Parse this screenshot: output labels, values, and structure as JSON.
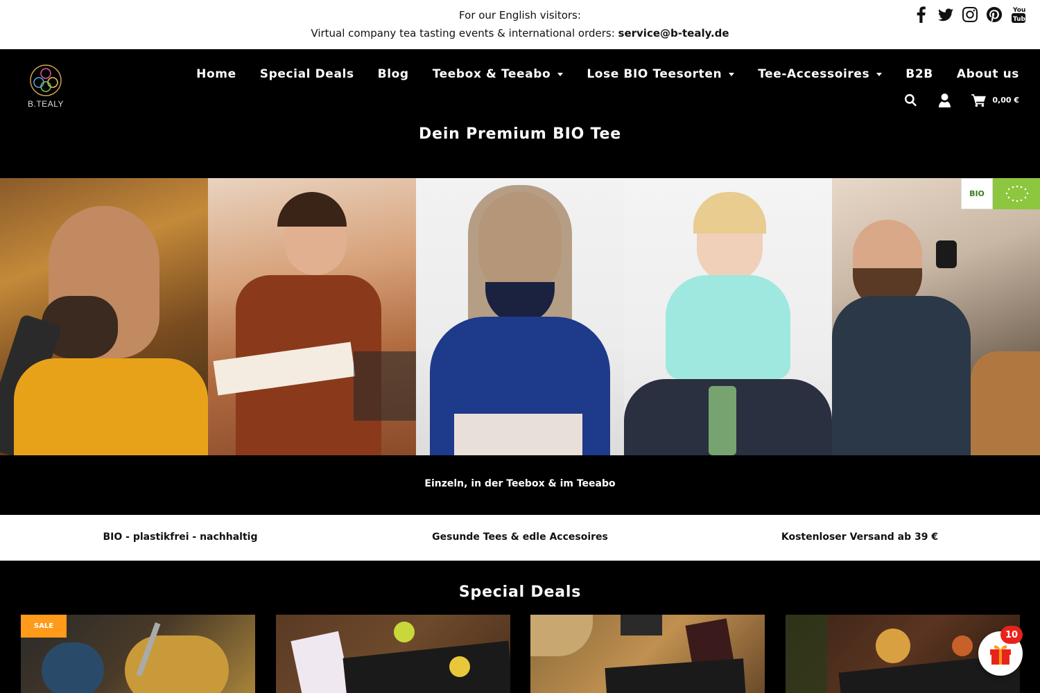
{
  "announcement": {
    "line1": "For our English visitors:",
    "line2_prefix": "Virtual company tea tasting events & international orders: ",
    "line2_email": "service@b-tealy.de"
  },
  "social": [
    "facebook-icon",
    "twitter-icon",
    "instagram-icon",
    "pinterest-icon",
    "youtube-icon"
  ],
  "logo": {
    "brand": "B.TEALY"
  },
  "nav": [
    {
      "label": "Home",
      "dropdown": false
    },
    {
      "label": "Special Deals",
      "dropdown": false
    },
    {
      "label": "Blog",
      "dropdown": false
    },
    {
      "label": "Teebox & Teeabo",
      "dropdown": true
    },
    {
      "label": "Lose BIO Teesorten",
      "dropdown": true
    },
    {
      "label": "Tee-Accessoires",
      "dropdown": true
    },
    {
      "label": "B2B",
      "dropdown": false
    },
    {
      "label": "About us",
      "dropdown": false
    }
  ],
  "cart": {
    "total": "0,00 €"
  },
  "hero": {
    "tagline": "Dein Premium BIO Tee",
    "subtitle": "Einzeln, in der Teebox & im Teeabo",
    "badge": "BIO"
  },
  "features": [
    "BIO - plastikfrei - nachhaltig",
    "Gesunde Tees & edle Accesoires",
    "Kostenloser Versand ab 39 €"
  ],
  "deals": {
    "title": "Special Deals",
    "sale_label": "SALE"
  },
  "gift": {
    "count": "10"
  },
  "colors": {
    "accent": "#ff9a1a",
    "badge": "#e8231b",
    "background": "#000000"
  }
}
